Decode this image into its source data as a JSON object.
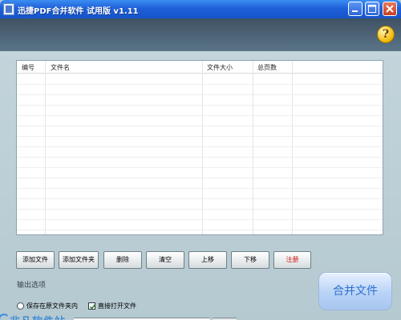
{
  "window": {
    "title": "迅捷PDF合并软件 试用版 v1.11"
  },
  "table": {
    "columns": [
      "编号",
      "文件名",
      "文件大小",
      "总页数"
    ],
    "rows": []
  },
  "toolbar": {
    "add_file": "添加文件",
    "add_folder": "添加文件夹",
    "delete": "删除",
    "clear": "清空",
    "move_up": "上移",
    "move_down": "下移",
    "register": "注册"
  },
  "output": {
    "section_label": "输出选项",
    "save_in_source_folder": "保存在原文件夹内",
    "open_directly": "直接打开文件",
    "open_directly_checked": true
  },
  "merge_button": "合并文件",
  "help_icon": "?",
  "icons": {
    "minimize": "minimize-icon",
    "maximize": "maximize-icon",
    "close": "close-icon",
    "help": "help-icon"
  },
  "colors": {
    "register_text": "#d21010",
    "merge_text": "#2e6fd0"
  }
}
